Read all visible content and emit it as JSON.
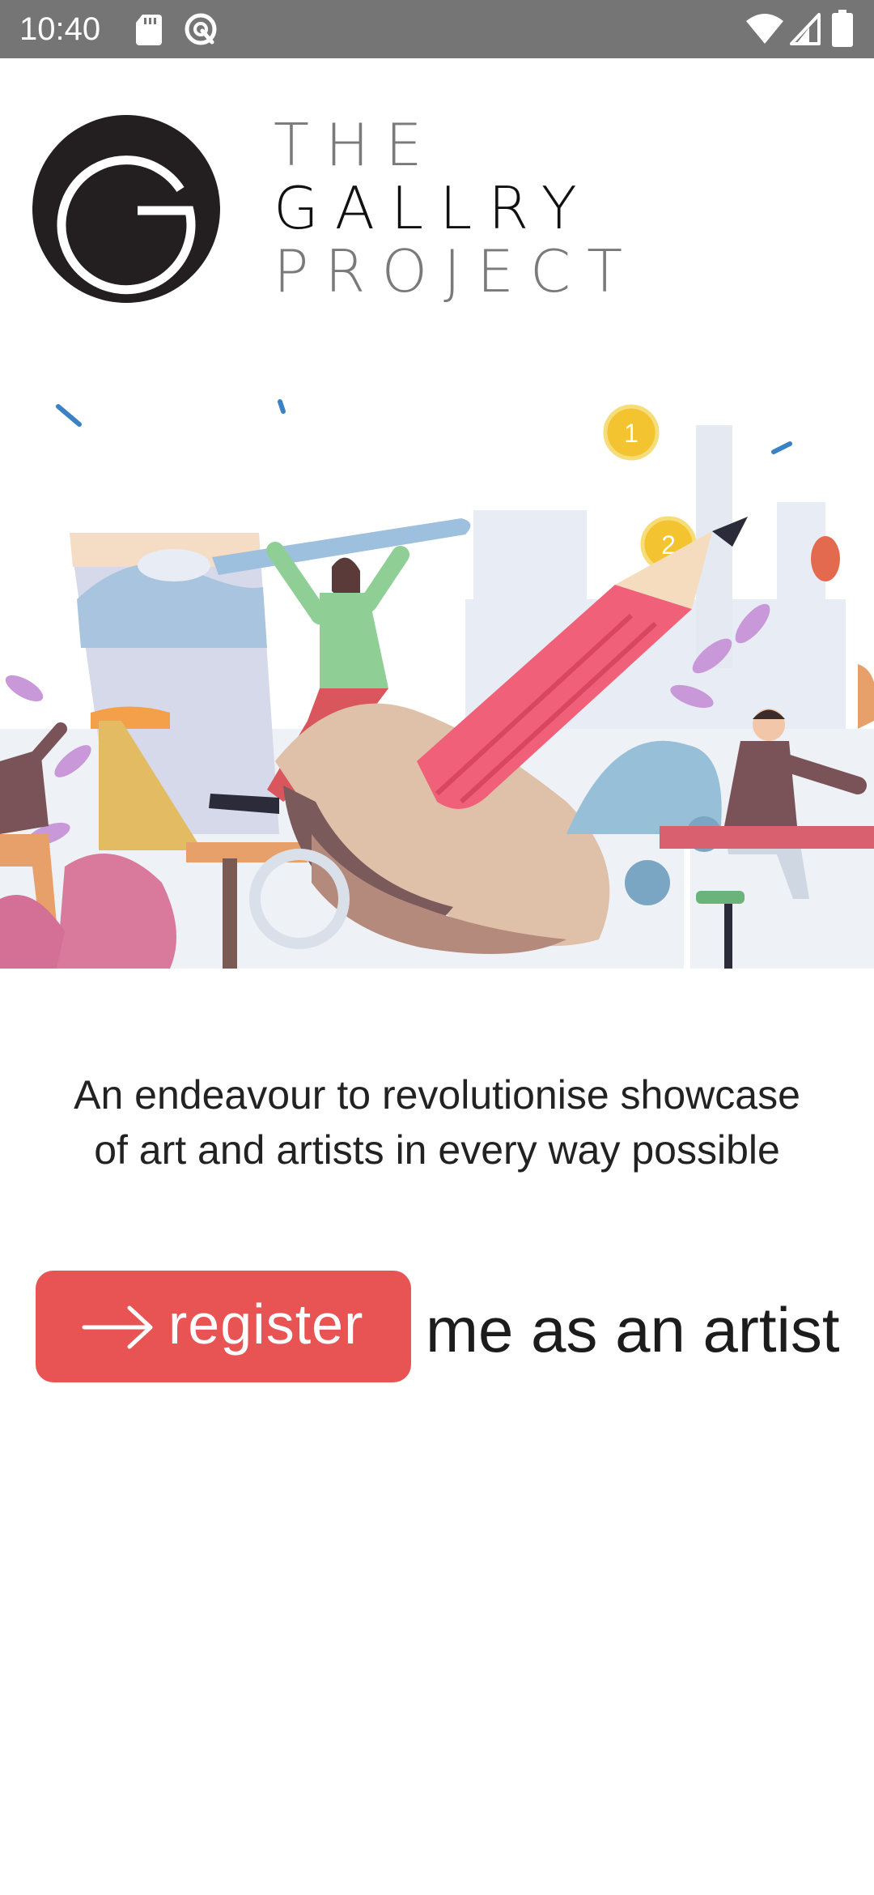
{
  "status_bar": {
    "time": "10:40",
    "left_icons": [
      "sd-card-icon",
      "sync-circle-icon"
    ],
    "right_icons": [
      "wifi-icon",
      "cell-signal-icon",
      "battery-icon"
    ]
  },
  "logo": {
    "icon": "gallry-g-logo-icon",
    "line1": "THE",
    "line2": "GALLRY",
    "line3": "PROJECT"
  },
  "hero": {
    "icon": "artists-illustration",
    "badges": [
      "1",
      "2"
    ]
  },
  "tagline": {
    "line1": "An endeavour to revolutionise showcase",
    "line2": "of art and artists in every way possible"
  },
  "register": {
    "icon": "arrow-right-icon",
    "button_label": "register",
    "suffix": "me as an artist",
    "color": "#e85454"
  }
}
